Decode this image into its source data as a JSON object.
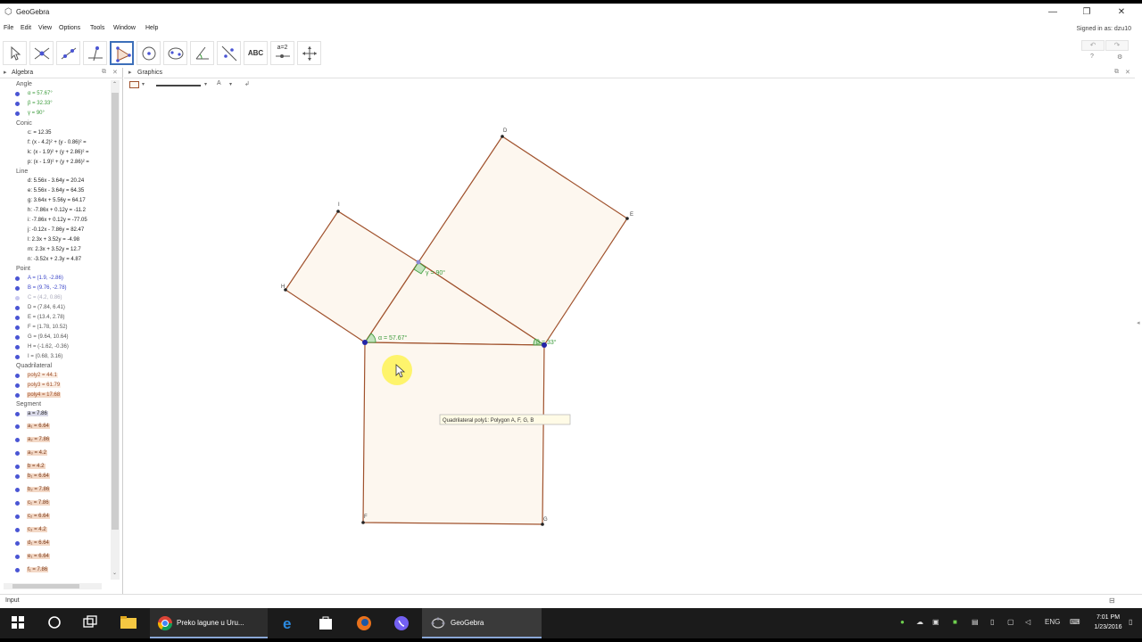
{
  "window": {
    "title": "GeoGebra"
  },
  "menu": {
    "items": [
      "File",
      "Edit",
      "View",
      "Options",
      "Tools",
      "Window",
      "Help"
    ],
    "signed_in": "Signed in as: dzu10"
  },
  "toolbar": {
    "abc_label": "ABC",
    "slider_label": "a=2"
  },
  "algebra": {
    "title": "Algebra",
    "categories": [
      "Angle",
      "Conic",
      "Line",
      "Point",
      "Quadrilateral",
      "Segment"
    ],
    "angle": [
      "α = 57.67°",
      "β = 32.33°",
      "γ = 90°"
    ],
    "conic": [
      "c: = 12.35",
      "f: (x - 4.2)² + (y - 0.86)² =",
      "k: (x - 1.9)² + (y + 2.86)² =",
      "p: (x - 1.9)² + (y + 2.86)² ="
    ],
    "line": [
      "d: 5.56x - 3.64y = 20.24",
      "e: 5.56x - 3.64y = 64.35",
      "g: 3.64x + 5.56y = 64.17",
      "h: -7.86x + 0.12y = -11.2",
      "i: -7.86x + 0.12y = -77.05",
      "j: -0.12x - 7.86y = 82.47",
      "l: 2.3x + 3.52y = -4.98",
      "m: 2.3x + 3.52y = 12.7",
      "n: -3.52x + 2.3y = 4.87"
    ],
    "point": [
      "A = (1.9, -2.86)",
      "B = (9.76, -2.78)",
      "C = (4.2, 0.86)",
      "D = (7.84, 6.41)",
      "E = (13.4, 2.78)",
      "F = (1.78, 10.52)",
      "G = (9.64, 10.64)",
      "H = (-1.62, -0.36)",
      "I = (0.68, 3.16)"
    ],
    "quadrilateral": [
      "poly2 = 44.1",
      "poly3 = 61.79",
      "poly4 = 17.68"
    ],
    "segment": [
      "a = 7.86",
      "a₁ = 6.64",
      "a₂ = 7.86",
      "a₃ = 4.2",
      "b = 4.2",
      "b₁ = 6.64",
      "b₂ = 7.86",
      "c₁ = 7.86",
      "c₂ = 6.64",
      "c₃ = 4.2",
      "d₁ = 6.64",
      "e₁ = 6.64",
      "f₁ = 7.86"
    ]
  },
  "graphics": {
    "title": "Graphics",
    "tooltip": "Quadrilateral poly1: Polygon A, F, G, B",
    "angle_labels": [
      "α = 57.67°",
      "β = 33°",
      "γ = 90°"
    ],
    "point_labels": [
      "D",
      "E",
      "I",
      "H",
      "F",
      "G"
    ]
  },
  "input_bar": {
    "label": "Input"
  },
  "taskbar": {
    "chrome_tab": "Preko lagune u Uru...",
    "geogebra_tab": "GeoGebra",
    "language": "ENG",
    "time": "7:01 PM",
    "date": "1/23/2016"
  },
  "colors": {
    "polygon_stroke": "#a0522d",
    "polygon_fill": "#fdf7ef",
    "angle_green": "#3a9a3a",
    "point_blue": "#2424a8",
    "algebra_dot": "#4a55d4"
  }
}
